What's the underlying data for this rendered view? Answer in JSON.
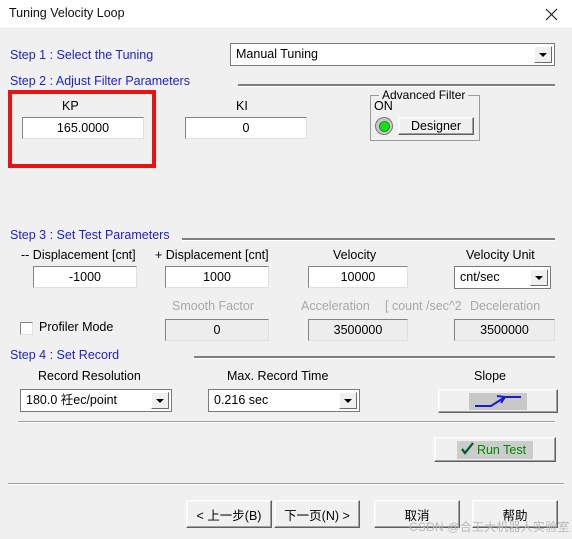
{
  "window": {
    "title": "Tuning Velocity Loop",
    "close_icon": "close-icon"
  },
  "steps": {
    "step1_label": "Step 1 : Select the  Tuning",
    "step2_label": "Step 2 :  Adjust Filter Parameters",
    "step3_label": "Step 3 : Set Test  Parameters",
    "step4_label": "Step 4 : Set Record"
  },
  "tuning_mode": {
    "value": "Manual Tuning",
    "arrow_icon": "chevron-down-icon"
  },
  "filter_params": {
    "kp_label": "KP",
    "kp_value": "165.0000",
    "ki_label": "KI",
    "ki_value": "0"
  },
  "advanced_filter": {
    "group_title": "Advanced Filter",
    "state_label": "ON",
    "led_icon": "led-indicator-icon",
    "designer_button": "Designer"
  },
  "test_params": {
    "neg_displacement_label": "-- Displacement [cnt]",
    "neg_displacement_value": "-1000",
    "pos_displacement_label": "+ Displacement [cnt]",
    "pos_displacement_value": "1000",
    "velocity_label": "Velocity",
    "velocity_value": "10000",
    "velocity_unit_label": "Velocity Unit",
    "velocity_unit_value": "cnt/sec",
    "profiler_mode_label": "Profiler Mode",
    "profiler_mode_checked": false,
    "smooth_factor_label": "Smooth Factor",
    "smooth_factor_value": "0",
    "acceleration_label": "Acceleration",
    "unit_note_label": "[ count /sec^2",
    "deceleration_label": "Deceleration",
    "acceleration_value": "3500000",
    "deceleration_value": "3500000"
  },
  "record": {
    "resolution_label": "Record Resolution",
    "resolution_value": "180.0 祍ec/point",
    "max_time_label": "Max. Record Time",
    "max_time_value": "0.216 sec",
    "slope_label": "Slope",
    "slope_icon": "slope-waveform-icon"
  },
  "actions": {
    "run_test_label": "Run Test",
    "run_test_check_icon": "check-icon",
    "back_label": "< 上一步(B)",
    "next_label": "下一页(N) >",
    "cancel_label": "取消",
    "help_label": "帮助"
  },
  "watermark": {
    "text": "CSDN @合工大机器人实验室"
  },
  "colors": {
    "step_blue": "#2222cc",
    "annotation_red": "#ee1111",
    "run_test_green": "#008800",
    "led_green": "#18e018",
    "dialog_gray": "#f0f0f0"
  }
}
